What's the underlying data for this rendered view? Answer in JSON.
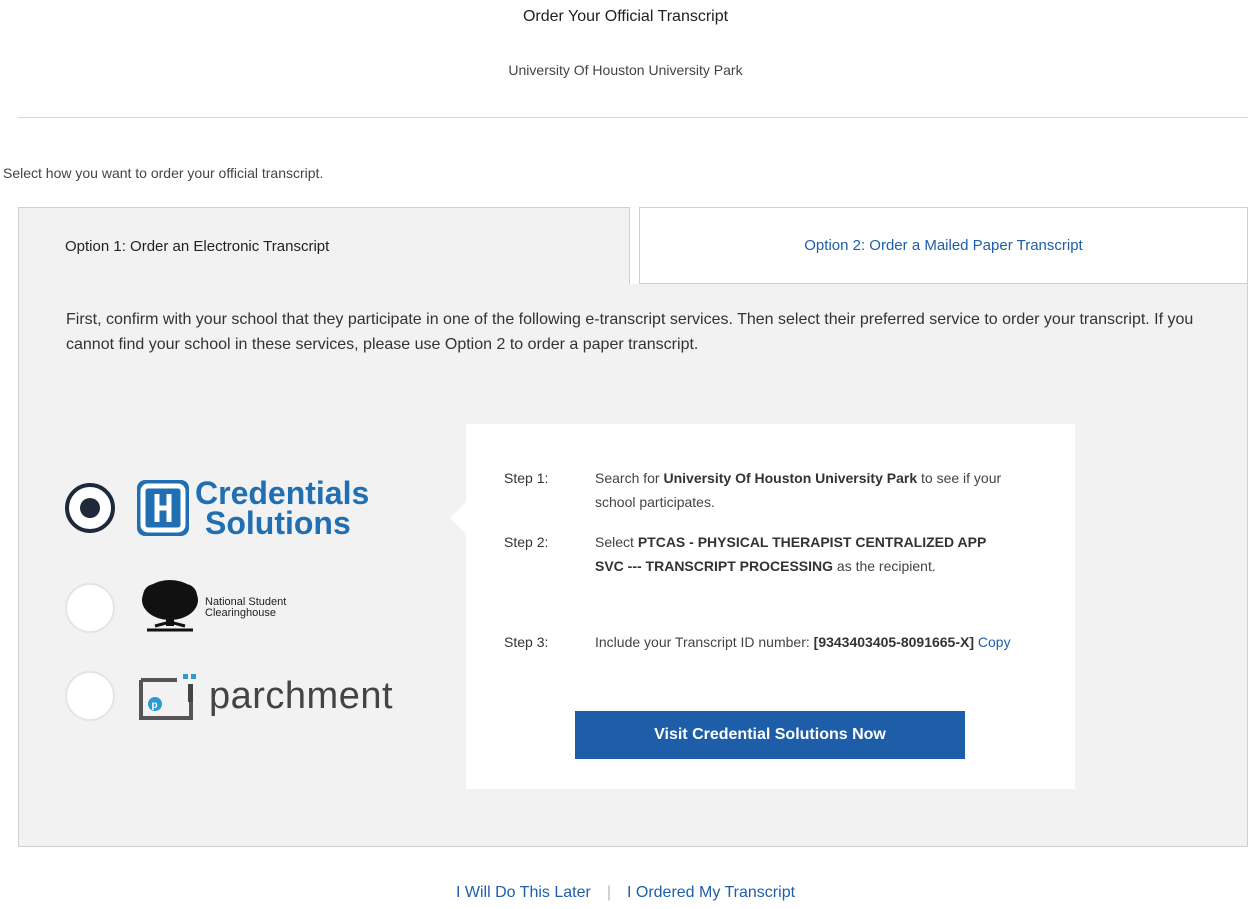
{
  "header": {
    "title": "Order Your Official Transcript",
    "subtitle": "University Of Houston University Park"
  },
  "instruction": "Select how you want to order your official transcript.",
  "tabs": [
    {
      "label": "Option 1: Order an Electronic Transcript",
      "active": true
    },
    {
      "label": "Option 2: Order a Mailed Paper Transcript",
      "active": false
    }
  ],
  "intro_text": "First, confirm with your school that they participate in one of the following e-transcript services. Then select their preferred service to order your transcript. If you cannot find your school in these services, please use Option 2 to order a paper transcript.",
  "services": [
    {
      "name": "Credentials Solutions",
      "logo_line1": "Credentials",
      "logo_line2": "Solutions",
      "logo_icon": "credentials-solutions-logo-icon",
      "selected": true
    },
    {
      "name": "National Student Clearinghouse",
      "logo_line1": "National Student",
      "logo_line2": "Clearinghouse",
      "logo_icon": "tree-logo-icon",
      "selected": false
    },
    {
      "name": "parchment",
      "logo_text": "parchment",
      "logo_icon": "parchment-logo-icon",
      "selected": false
    }
  ],
  "steps": {
    "step1": {
      "label": "Step 1:",
      "pre": "Search for ",
      "bold": "University Of Houston University Park",
      "post": " to see if your school participates."
    },
    "step2": {
      "label": "Step 2:",
      "pre": "Select ",
      "bold": "PTCAS - PHYSICAL THERAPIST CENTRALIZED APP SVC --- TRANSCRIPT PROCESSING",
      "post": " as the recipient."
    },
    "step3": {
      "label": "Step 3:",
      "pre": "Include your Transcript ID number: ",
      "bold": "[9343403405-8091665-X]",
      "copy": "Copy"
    }
  },
  "visit_button": "Visit Credential Solutions Now",
  "footer": {
    "later": "I Will Do This Later",
    "separator": "|",
    "ordered": "I Ordered My Transcript"
  },
  "colors": {
    "link_blue": "#1f5ea8",
    "button_blue": "#1e5ea8",
    "credentials_blue": "#1f6fb2",
    "panel_gray": "#f2f2f2"
  }
}
